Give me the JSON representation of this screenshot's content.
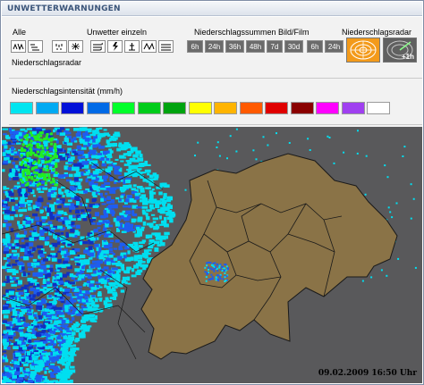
{
  "header": {
    "title": "UNWETTERWARNUNGEN"
  },
  "controls": {
    "all_label": "Alle",
    "single_label": "Unwetter einzeln",
    "sums_label": "Niederschlagssummen Bild/Film",
    "radar_label": "Niederschlagsradar",
    "radar_sub_label": "Niederschlagsradar",
    "sum_buttons": [
      "6h",
      "24h",
      "36h",
      "48h",
      "7d",
      "30d",
      "6h",
      "24h"
    ],
    "radar_future_badge": "+1h"
  },
  "legend": {
    "title": "Niederschlagsintensität (mm/h)",
    "colors": [
      "#00e5f0",
      "#00aaf2",
      "#0010d8",
      "#006ae6",
      "#00ff2a",
      "#00cc1a",
      "#00a30f",
      "#ffff00",
      "#ffb400",
      "#ff5a00",
      "#e00000",
      "#8a0000",
      "#ff00ff",
      "#a040f0",
      "#ffffff"
    ]
  },
  "map": {
    "timestamp": "09.02.2009 16:50 Uhr",
    "background_color": "#59595b",
    "land_color": "#8a7347",
    "radar_colors": {
      "light": "#00dff0",
      "medium": "#1e5df0",
      "strong": "#1030c0",
      "green": "#22ee22"
    }
  }
}
